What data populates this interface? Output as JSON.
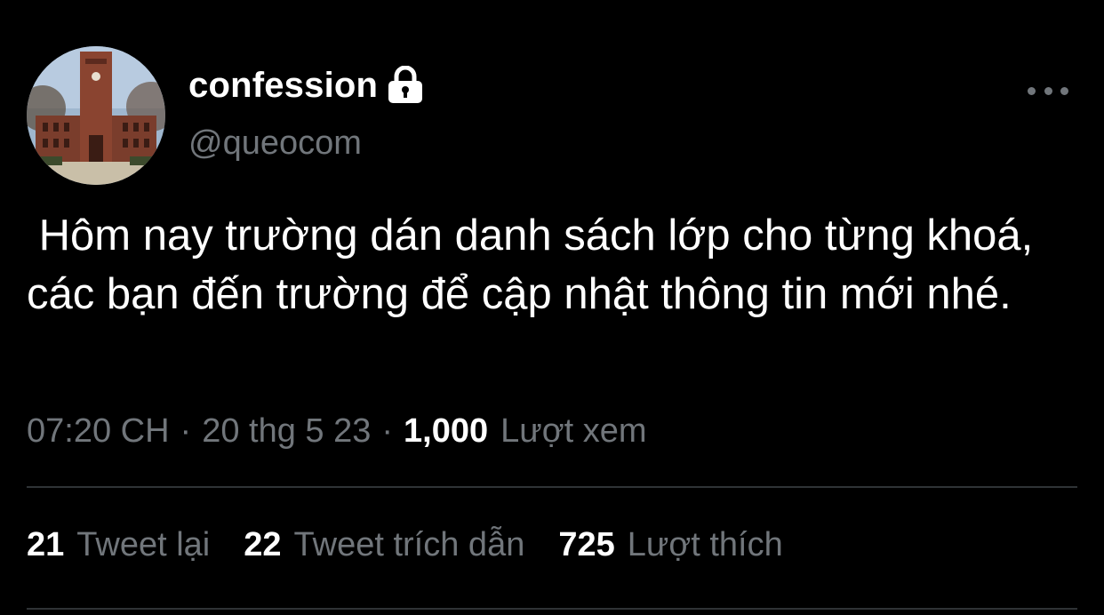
{
  "user": {
    "display_name": "confession",
    "handle": "@queocom",
    "protected_icon": "lock-icon"
  },
  "more_icon": "more-horizontal-icon",
  "tweet": {
    "text": " Hôm nay trường dán danh sách lớp cho từng khoá, các bạn đến trường để cập nhật thông tin mới nhé."
  },
  "meta": {
    "time": "07:20 CH",
    "separator": "·",
    "date": "20 thg 5 23",
    "views_count": "1,000",
    "views_label": "Lượt xem"
  },
  "stats": {
    "retweets_count": "21",
    "retweets_label": "Tweet lại",
    "quotes_count": "22",
    "quotes_label": "Tweet trích dẫn",
    "likes_count": "725",
    "likes_label": "Lượt thích"
  },
  "colors": {
    "background": "#000000",
    "primary_text": "#ffffff",
    "secondary_text": "#71767b",
    "divider": "#2f3336"
  }
}
